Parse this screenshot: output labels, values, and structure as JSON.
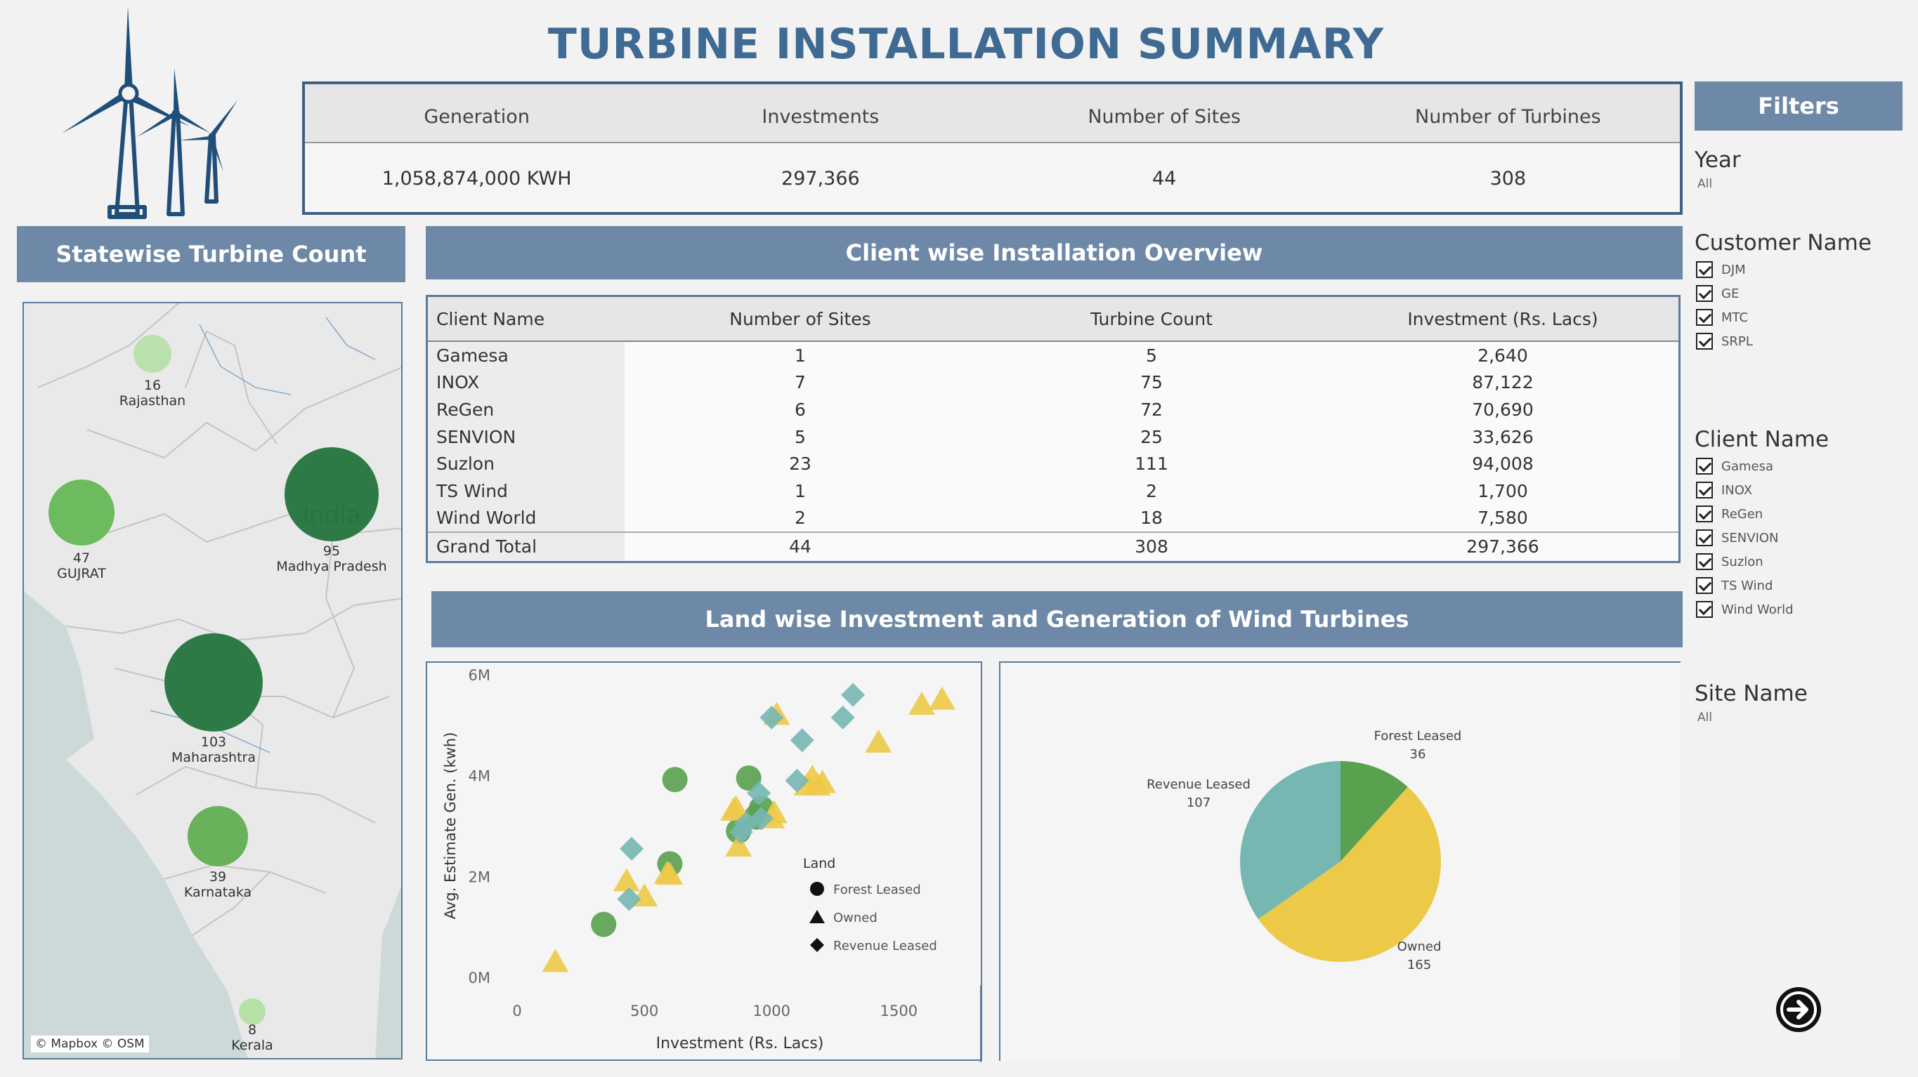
{
  "title": "TURBINE INSTALLATION SUMMARY",
  "kpis": [
    {
      "label": "Generation",
      "value": "1,058,874,000 KWH"
    },
    {
      "label": "Investments",
      "value": "297,366"
    },
    {
      "label": "Number of Sites",
      "value": "44"
    },
    {
      "label": "Number of Turbines",
      "value": "308"
    }
  ],
  "map_panel": {
    "title": "Statewise Turbine Count",
    "country_label": "India",
    "credit": "© Mapbox © OSM",
    "states": [
      {
        "name": "Rajasthan",
        "count": "16"
      },
      {
        "name": "GUJRAT",
        "count": "47"
      },
      {
        "name": "Madhya Pradesh",
        "count": "95"
      },
      {
        "name": "Maharashtra",
        "count": "103"
      },
      {
        "name": "Karnataka",
        "count": "39"
      },
      {
        "name": "Kerala",
        "count": "8"
      }
    ]
  },
  "client_panel": {
    "title": "Client wise Installation Overview",
    "columns": [
      "Client Name",
      "Number of Sites",
      "Turbine Count",
      "Investment (Rs. Lacs)"
    ],
    "rows": [
      [
        "Gamesa",
        "1",
        "5",
        "2,640"
      ],
      [
        "INOX",
        "7",
        "75",
        "87,122"
      ],
      [
        "ReGen",
        "6",
        "72",
        "70,690"
      ],
      [
        "SENVION",
        "5",
        "25",
        "33,626"
      ],
      [
        "Suzlon",
        "23",
        "111",
        "94,008"
      ],
      [
        "TS Wind",
        "1",
        "2",
        "1,700"
      ],
      [
        "Wind World",
        "2",
        "18",
        "7,580"
      ]
    ],
    "total": [
      "Grand Total",
      "44",
      "308",
      "297,366"
    ]
  },
  "land_panel": {
    "title": "Land wise Investment and Generation of Wind Turbines"
  },
  "colors": {
    "forest": "#59a14f",
    "owned": "#edc948",
    "revenue": "#76b7b2",
    "banner": "#6d89a7",
    "title": "#3e6a93"
  },
  "chart_data": [
    {
      "type": "scatter",
      "xlabel": "Investment (Rs. Lacs)",
      "ylabel": "Avg. Estimate Gen. (kwh)",
      "x_ticks": [
        "0",
        "500",
        "1000",
        "1500"
      ],
      "y_ticks": [
        "0M",
        "2M",
        "4M",
        "6M"
      ],
      "xlim": [
        -50,
        1800
      ],
      "ylim": [
        0,
        6000000
      ],
      "legend_title": "Land",
      "legend_position": "right",
      "series": [
        {
          "name": "Forest Leased",
          "shape": "circle",
          "points": [
            [
              340,
              1050000
            ],
            [
              600,
              2250000
            ],
            [
              620,
              3920000
            ],
            [
              870,
              2900000
            ],
            [
              910,
              3950000
            ],
            [
              940,
              3180000
            ],
            [
              960,
              3350000
            ]
          ]
        },
        {
          "name": "Owned",
          "shape": "triangle",
          "points": [
            [
              150,
              300000
            ],
            [
              430,
              1900000
            ],
            [
              500,
              1600000
            ],
            [
              600,
              2030000
            ],
            [
              590,
              2050000
            ],
            [
              850,
              3300000
            ],
            [
              860,
              3350000
            ],
            [
              870,
              2590000
            ],
            [
              1000,
              3150000
            ],
            [
              1010,
              3250000
            ],
            [
              1020,
              5200000
            ],
            [
              1140,
              3800000
            ],
            [
              1160,
              3950000
            ],
            [
              1180,
              3800000
            ],
            [
              1200,
              3850000
            ],
            [
              1420,
              4650000
            ],
            [
              1590,
              5400000
            ],
            [
              1670,
              5500000
            ]
          ]
        },
        {
          "name": "Revenue Leased",
          "shape": "diamond",
          "points": [
            [
              440,
              1550000
            ],
            [
              450,
              2550000
            ],
            [
              880,
              2880000
            ],
            [
              900,
              3050000
            ],
            [
              950,
              3650000
            ],
            [
              960,
              3150000
            ],
            [
              1000,
              5150000
            ],
            [
              1100,
              3900000
            ],
            [
              1120,
              4700000
            ],
            [
              1280,
              5150000
            ],
            [
              1320,
              5600000
            ]
          ]
        }
      ]
    },
    {
      "type": "pie",
      "slices": [
        {
          "label": "Forest Leased",
          "value": 36
        },
        {
          "label": "Owned",
          "value": 165
        },
        {
          "label": "Revenue Leased",
          "value": 107
        }
      ]
    }
  ],
  "filters": {
    "title": "Filters",
    "year": {
      "label": "Year",
      "value": "All"
    },
    "customer": {
      "label": "Customer Name",
      "items": [
        "DJM",
        "GE",
        "MTC",
        "SRPL"
      ]
    },
    "client": {
      "label": "Client Name",
      "items": [
        "Gamesa",
        "INOX",
        "ReGen",
        "SENVION",
        "Suzlon",
        "TS Wind",
        "Wind World"
      ]
    },
    "site": {
      "label": "Site Name",
      "value": "All"
    }
  }
}
